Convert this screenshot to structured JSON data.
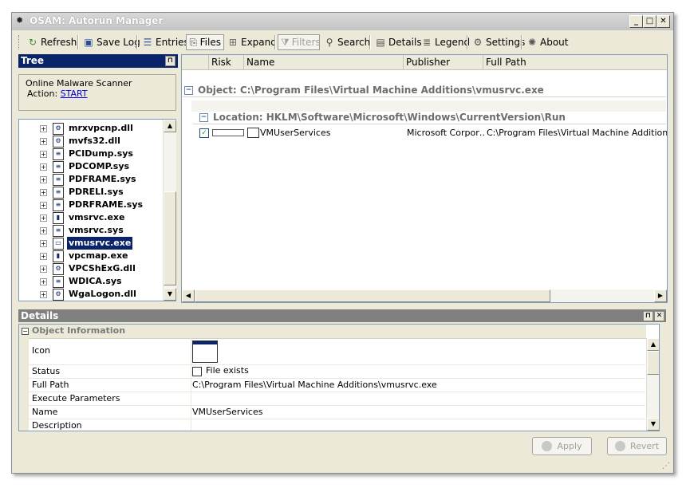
{
  "window": {
    "title": "OSAM: Autorun Manager",
    "app_icon": "gear-icon",
    "controls": [
      "_",
      "□",
      "✕"
    ]
  },
  "toolbar": {
    "refresh": "Refresh",
    "save_log": "Save Log",
    "entries": "Entries",
    "files": "Files",
    "expand": "Expand",
    "filters": "Filters",
    "search": "Search",
    "details": "Details",
    "legend": "Legend",
    "settings": "Settings",
    "about": "About"
  },
  "tree_panel": {
    "title": "Tree",
    "scanner_title": "Online Malware Scanner",
    "action_label": "Action:",
    "action_link": "START",
    "items": [
      {
        "name": "mrxvpcnp.dll",
        "icon": "dll-icon"
      },
      {
        "name": "mvfs32.dll",
        "icon": "dll-icon"
      },
      {
        "name": "PCIDump.sys",
        "icon": "sys-icon"
      },
      {
        "name": "PDCOMP.sys",
        "icon": "sys-icon"
      },
      {
        "name": "PDFRAME.sys",
        "icon": "sys-icon"
      },
      {
        "name": "PDRELI.sys",
        "icon": "sys-icon"
      },
      {
        "name": "PDRFRAME.sys",
        "icon": "sys-icon"
      },
      {
        "name": "vmsrvc.exe",
        "icon": "exe-icon"
      },
      {
        "name": "vmsrvc.sys",
        "icon": "sys-icon"
      },
      {
        "name": "vmusrvc.exe",
        "icon": "window-icon",
        "selected": true
      },
      {
        "name": "vpcmap.exe",
        "icon": "exe-icon"
      },
      {
        "name": "VPCShExG.dll",
        "icon": "dll-icon"
      },
      {
        "name": "WDICA.sys",
        "icon": "sys-icon"
      },
      {
        "name": "WgaLogon.dll",
        "icon": "dll-icon"
      }
    ]
  },
  "list_panel": {
    "columns": [
      "Risk",
      "Name",
      "Publisher",
      "Full Path"
    ],
    "group_object": "Object: C:\\Program Files\\Virtual Machine Additions\\vmusrvc.exe",
    "group_location": "Location: HKLM\\Software\\Microsoft\\Windows\\CurrentVersion\\Run",
    "row": {
      "checked": true,
      "name": "VMUserServices",
      "publisher": "Microsoft Corpor…",
      "full_path": "C:\\Program Files\\Virtual Machine Additions\\vmu"
    }
  },
  "details_panel": {
    "title": "Details",
    "section": "Object Information",
    "props": [
      {
        "name": "Icon",
        "value": ""
      },
      {
        "name": "Status",
        "value": "File exists"
      },
      {
        "name": "Full Path",
        "value": "C:\\Program Files\\Virtual Machine Additions\\vmusrvc.exe"
      },
      {
        "name": "Execute Parameters",
        "value": ""
      },
      {
        "name": "Name",
        "value": "VMUserServices"
      },
      {
        "name": "Description",
        "value": ""
      }
    ]
  },
  "buttons": {
    "apply": "Apply",
    "revert": "Revert"
  }
}
